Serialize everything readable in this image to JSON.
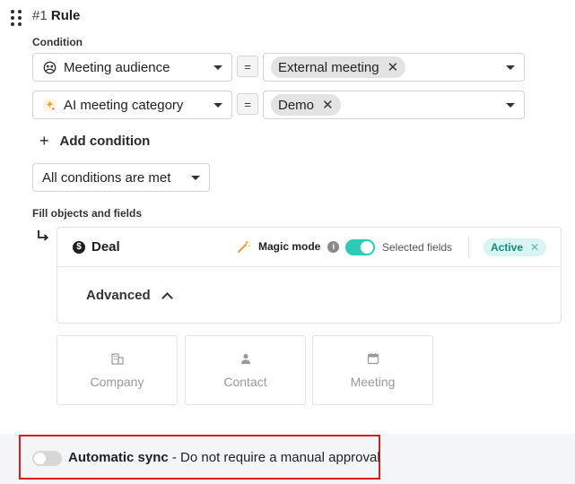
{
  "rule": {
    "number": "#1",
    "name": "Rule"
  },
  "condition": {
    "label": "Condition",
    "rows": [
      {
        "field": "Meeting audience",
        "operator": "=",
        "values": [
          "External meeting"
        ]
      },
      {
        "field": "AI meeting category",
        "operator": "=",
        "values": [
          "Demo"
        ]
      }
    ],
    "add_label": "Add condition",
    "match_mode": "All conditions are met"
  },
  "fill": {
    "label": "Fill objects and fields",
    "card": {
      "title": "Deal",
      "magic_mode": "Magic mode",
      "magic_mode_on": true,
      "selected_fields": "Selected fields",
      "status": "Active",
      "advanced": "Advanced"
    },
    "objects": [
      "Company",
      "Contact",
      "Meeting"
    ]
  },
  "sync": {
    "enabled": false,
    "title": "Automatic sync",
    "description": "- Do not require a manual approval"
  },
  "colors": {
    "accent": "#2fc9b8",
    "active_bg": "#d9f5f1",
    "active_text": "#15897b",
    "highlight": "#e11b1b"
  }
}
